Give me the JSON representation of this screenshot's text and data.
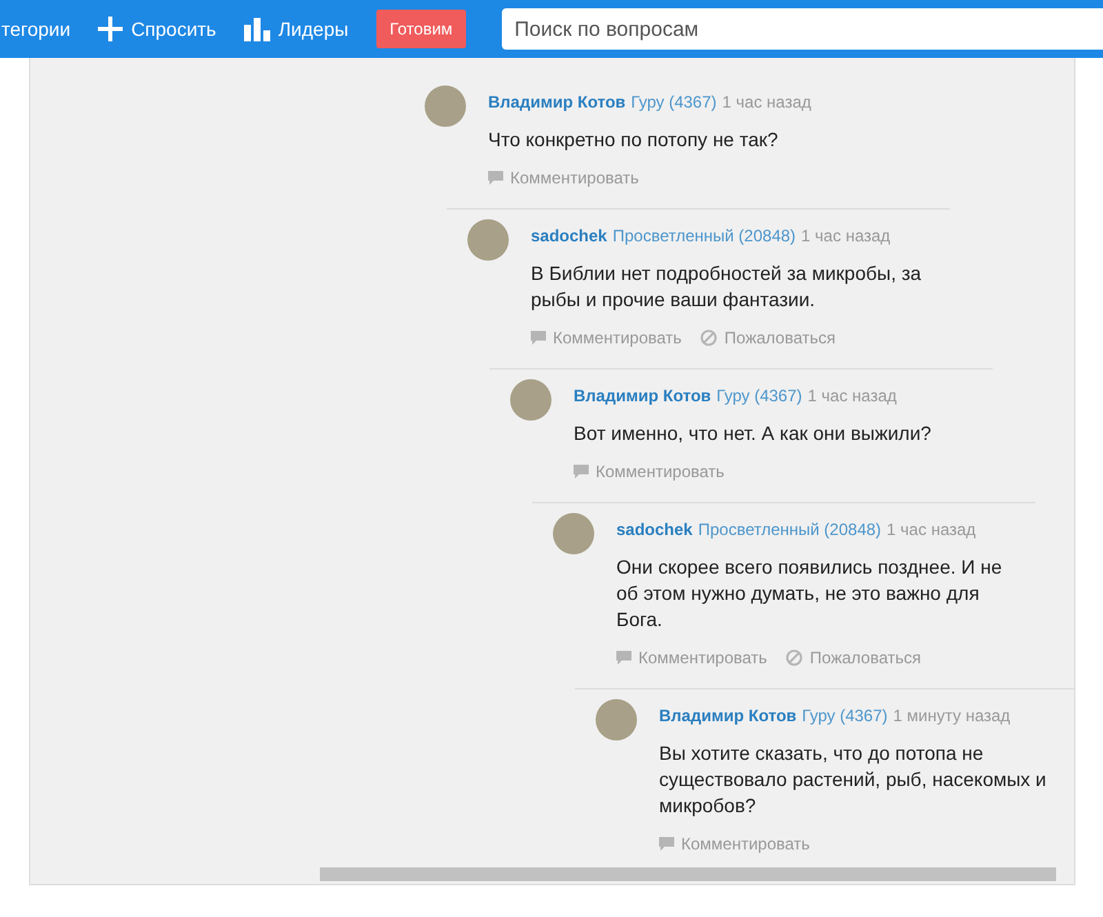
{
  "nav": {
    "items": [
      {
        "label": "тегории"
      },
      {
        "label": "Спросить"
      },
      {
        "label": "Лидеры"
      }
    ],
    "promo_button": "Готовим",
    "search": {
      "placeholder": "Поиск по вопросам"
    }
  },
  "comments": [
    {
      "author": "Владимир Котов",
      "rank": "Гуру (4367)",
      "time": "1 час назад",
      "text": "Что конкретно по потопу не так?",
      "actions": [
        "Комментировать"
      ],
      "children": [
        {
          "author": "sadochek",
          "rank": "Просветленный (20848)",
          "time": "1 час назад",
          "text": "В Библии нет подробностей за микробы, за рыбы и прочие ваши фантазии.",
          "actions": [
            "Комментировать",
            "Пожаловаться"
          ],
          "children": [
            {
              "author": "Владимир Котов",
              "rank": "Гуру (4367)",
              "time": "1 час назад",
              "text": "Вот именно, что нет. А как они выжили?",
              "actions": [
                "Комментировать"
              ],
              "children": [
                {
                  "author": "sadochek",
                  "rank": "Просветленный (20848)",
                  "time": "1 час назад",
                  "text": "Они скорее всего появились позднее. И не об этом нужно думать, не это важно для Бога.",
                  "actions": [
                    "Комментировать",
                    "Пожаловаться"
                  ],
                  "children": [
                    {
                      "author": "Владимир Котов",
                      "rank": "Гуру (4367)",
                      "time": "1 минуту назад",
                      "text": "Вы хотите сказать, что до потопа не существовало растений, рыб, насекомых и микробов?",
                      "actions": [
                        "Комментировать"
                      ]
                    }
                  ]
                }
              ]
            }
          ]
        }
      ]
    }
  ]
}
